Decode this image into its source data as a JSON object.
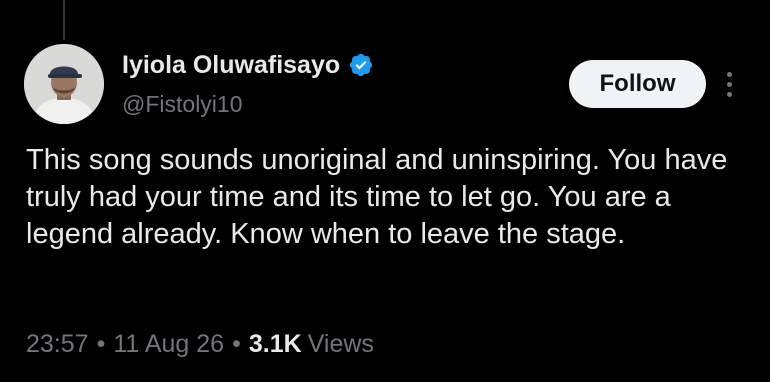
{
  "author": {
    "display_name": "Iyiola Oluwafisayo",
    "handle": "@Fistolyi10",
    "verified": true,
    "verified_icon": "verified-badge-icon",
    "verified_color": "#1d9bf0"
  },
  "actions": {
    "follow_label": "Follow",
    "more_icon": "more-vertical-icon"
  },
  "tweet": {
    "text": "This song sounds unoriginal and uninspiring. You have truly had your time and its time to let go. You are a legend already. Know when to leave the stage."
  },
  "meta": {
    "time": "23:57",
    "separator": "•",
    "date": "11 Aug 26",
    "views_count": "3.1K",
    "views_label": "Views"
  },
  "colors": {
    "background": "#000000",
    "text_primary": "#e7e9ea",
    "text_secondary": "#71767b",
    "follow_button_bg": "#eff3f4",
    "follow_button_text": "#0f1419"
  }
}
